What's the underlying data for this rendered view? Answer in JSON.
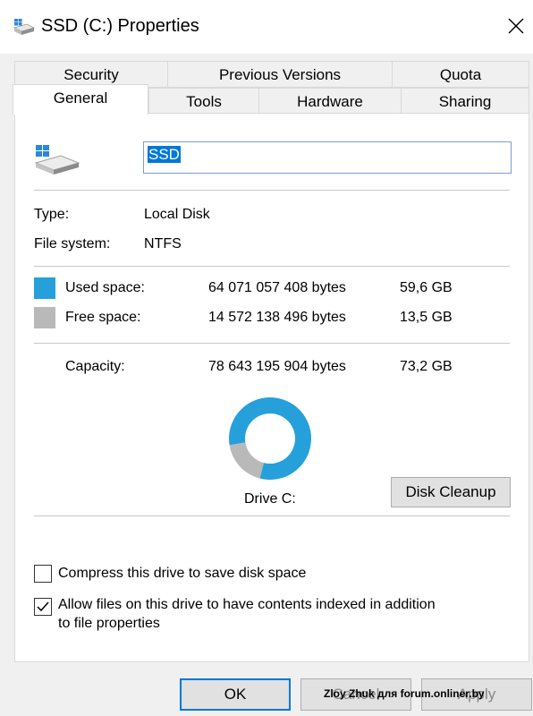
{
  "window": {
    "title": "SSD (C:) Properties"
  },
  "tabs": {
    "row_back": [
      "Security",
      "Previous Versions",
      "Quota"
    ],
    "row_front": [
      "General",
      "Tools",
      "Hardware",
      "Sharing"
    ],
    "active": "General"
  },
  "general": {
    "drive_name": "SSD",
    "type_label": "Type:",
    "type_value": "Local Disk",
    "fs_label": "File system:",
    "fs_value": "NTFS",
    "used_label": "Used space:",
    "used_bytes": "64 071 057 408 bytes",
    "used_gb": "59,6 GB",
    "free_label": "Free space:",
    "free_bytes": "14 572 138 496 bytes",
    "free_gb": "13,5 GB",
    "capacity_label": "Capacity:",
    "capacity_bytes": "78 643 195 904 bytes",
    "capacity_gb": "73,2 GB",
    "drive_label": "Drive C:",
    "cleanup_button": "Disk Cleanup",
    "used_fraction": 0.815,
    "used_color": "#26a0da",
    "free_color": "#b9b9b9"
  },
  "options": {
    "compress_label": "Compress this drive to save disk space",
    "compress_checked": false,
    "index_label_line1": "Allow files on this drive to have contents indexed in addition",
    "index_label_line2": "to file properties",
    "index_checked": true
  },
  "footer": {
    "ok_label": "OK",
    "cancel_label": "Cancel",
    "apply_label": "Apply",
    "watermark": "Zloy Zhuk для forum.onliner.by"
  }
}
